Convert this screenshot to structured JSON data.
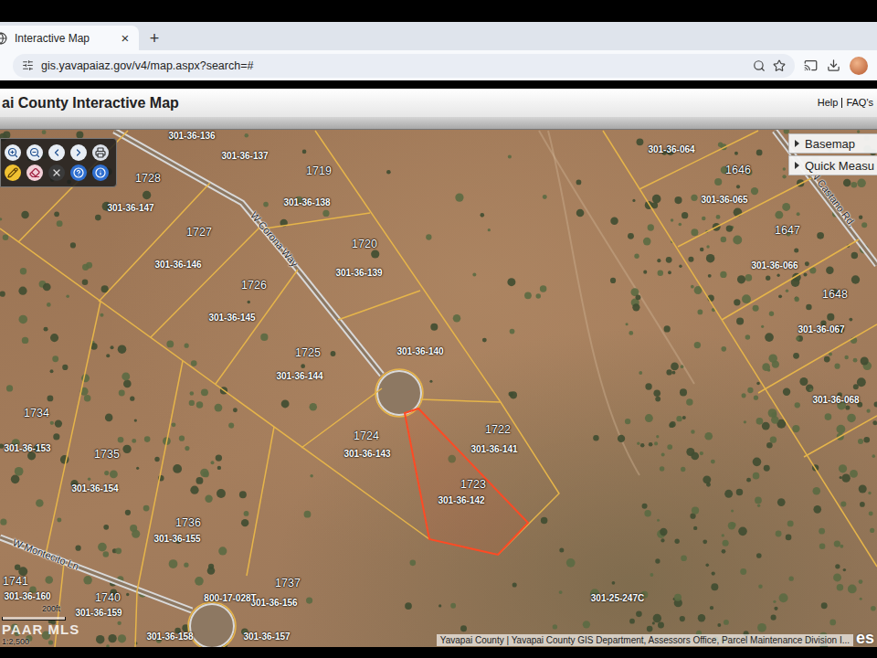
{
  "browser": {
    "tab": {
      "title": "Interactive Map",
      "close": "×",
      "selected": true
    },
    "new_tab": "+",
    "url": "gis.yavapaiaz.gov/v4/map.aspx?search=#"
  },
  "app": {
    "title": "ai County Interactive Map",
    "links": [
      "Help",
      "FAQ's"
    ]
  },
  "map_panel": {
    "items": [
      {
        "label": "Basemap",
        "expanded": false
      },
      {
        "label": "Quick Measu",
        "expanded": false
      }
    ]
  },
  "parcels": [
    {
      "lot": "1728",
      "apn": "301-36-147",
      "selected": false
    },
    {
      "lot": "1719",
      "apn": "301-36-138",
      "selected": false
    },
    {
      "lot": "1727",
      "apn": "301-36-146",
      "selected": false
    },
    {
      "lot": "1720",
      "apn": "301-36-139",
      "selected": false
    },
    {
      "lot": "1726",
      "apn": "301-36-145",
      "selected": false
    },
    {
      "lot": "1725",
      "apn": "301-36-144",
      "selected": false
    },
    {
      "lot": null,
      "apn": "301-36-140",
      "selected": false
    },
    {
      "lot": "1724",
      "apn": "301-36-143",
      "selected": false
    },
    {
      "lot": "1722",
      "apn": "301-36-141",
      "selected": false
    },
    {
      "lot": "1723",
      "apn": "301-36-142",
      "selected": true
    },
    {
      "lot": "1734",
      "apn": "301-36-153",
      "selected": false
    },
    {
      "lot": "1735",
      "apn": "301-36-154",
      "selected": false
    },
    {
      "lot": "1736",
      "apn": "301-36-155",
      "selected": false
    },
    {
      "lot": "1737",
      "apn": "301-36-156",
      "selected": false
    },
    {
      "lot": "1741",
      "apn": "301-36-160",
      "selected": false
    },
    {
      "lot": "1740",
      "apn": "301-36-159",
      "selected": false
    },
    {
      "lot": null,
      "apn": "301-36-158",
      "selected": false
    },
    {
      "lot": null,
      "apn": "301-36-157",
      "selected": false
    },
    {
      "lot": null,
      "apn": "301-36-136",
      "selected": false
    },
    {
      "lot": null,
      "apn": "301-36-137",
      "selected": false
    },
    {
      "lot": null,
      "apn": "800-17-028T",
      "selected": false
    },
    {
      "lot": null,
      "apn": "301-25-247C",
      "selected": false
    },
    {
      "lot": null,
      "apn": "301-36-064",
      "selected": false
    },
    {
      "lot": "1646",
      "apn": "301-36-065",
      "selected": false
    },
    {
      "lot": "1647",
      "apn": "301-36-066",
      "selected": false
    },
    {
      "lot": "1648",
      "apn": "301-36-067",
      "selected": false
    },
    {
      "lot": null,
      "apn": "301-36-068",
      "selected": false
    }
  ],
  "roads": [
    {
      "name": "W Corona Way"
    },
    {
      "name": "N Castano Rd."
    },
    {
      "name": "W Montecito Ln"
    }
  ],
  "scale": {
    "distance": "200ft",
    "ratio": "1:2,500"
  },
  "watermark": "PAAR MLS",
  "attribution": "Yavapai County | Yavapai County GIS Department, Assessors Office, Parcel Maintenance Division I...",
  "logo": "es"
}
